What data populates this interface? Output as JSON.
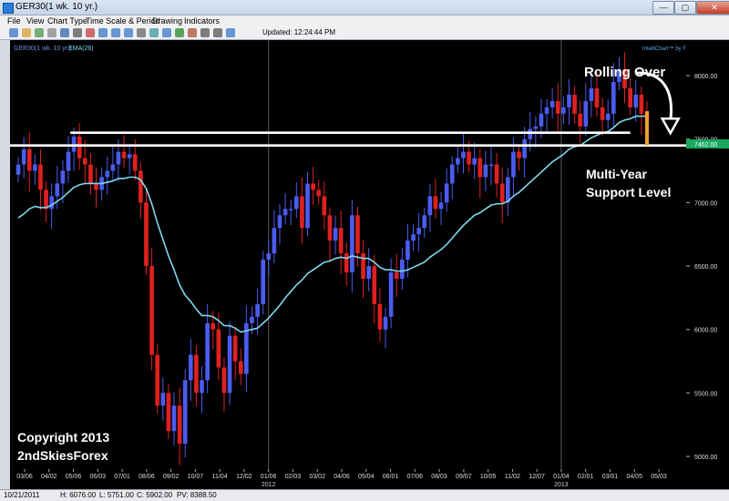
{
  "window": {
    "title": "GER30(1 wk.  10 yr.)",
    "controls": [
      "—",
      "▢",
      "✕"
    ]
  },
  "menu": [
    "File",
    "View",
    "Chart Type",
    "Time Scale & Period",
    "Drawing",
    "Indicators"
  ],
  "toolbar": {
    "updated": "Updated: 12:24:44 PM",
    "icons": [
      "new-icon",
      "open-icon",
      "save-icon",
      "print-icon",
      "line-tool-icon",
      "cursor-icon",
      "text-tool-icon",
      "crosshair-icon",
      "zoom-in-icon",
      "zoom-out-icon",
      "hand-icon",
      "fibonacci-icon",
      "bars-icon",
      "text-icon",
      "color-icon",
      "step-back-icon",
      "step-forward-icon",
      "pan-icon"
    ]
  },
  "legend": {
    "symbol": "GER30(1 wk.  10 yr.)",
    "ema": "EMA(26)",
    "watermark": "IntelliChart™ by FXtrek.com"
  },
  "annotations": {
    "rolling_over": "Rolling Over",
    "support_1": "Multi-Year",
    "support_2": "Support Level",
    "copyright_1": "Copyright 2013",
    "copyright_2": "2ndSkiesForex"
  },
  "status": {
    "date": "10/21/2011",
    "high": "H: 6076.00",
    "low": "L: 5751.00",
    "close": "C: 5902.00",
    "pv": "PV: 8388.50"
  },
  "chart_data": {
    "type": "candlestick",
    "symbol": "GER30",
    "timeframe": "1 wk",
    "ylim": [
      4900,
      8280
    ],
    "y_ticks": [
      5000,
      5500,
      6000,
      6500,
      7000,
      7500,
      8000
    ],
    "current_price": "7462.00",
    "x_ticks": [
      "03/06",
      "04/02",
      "05/06",
      "06/03",
      "07/01",
      "08/06",
      "09/02",
      "10/07",
      "11/04",
      "12/02",
      "01/06",
      "02/03",
      "03/02",
      "04/06",
      "05/04",
      "06/01",
      "07/06",
      "08/03",
      "09/07",
      "10/05",
      "11/02",
      "12/07",
      "01/04",
      "02/01",
      "03/01",
      "04/05",
      "05/03"
    ],
    "year_labels": [
      {
        "label": "2012",
        "at": "01/06"
      },
      {
        "label": "2013",
        "at": "01/04"
      }
    ],
    "support_lines": [
      7450,
      7550
    ],
    "closes": [
      7300,
      7420,
      7250,
      7300,
      7100,
      6950,
      7050,
      7150,
      7250,
      7400,
      7520,
      7350,
      7300,
      7150,
      7100,
      7200,
      7250,
      7300,
      7400,
      7350,
      7380,
      7250,
      7000,
      6500,
      5800,
      5400,
      5500,
      5200,
      5400,
      5100,
      5600,
      5800,
      5500,
      5600,
      6050,
      6000,
      5700,
      5500,
      5950,
      5750,
      5650,
      6050,
      6100,
      6200,
      6550,
      6600,
      6800,
      6900,
      6950,
      6950,
      7050,
      6800,
      7150,
      7100,
      7050,
      6900,
      6700,
      6800,
      6600,
      6450,
      6900,
      6600,
      6400,
      6500,
      6200,
      6000,
      6100,
      6450,
      6400,
      6550,
      6700,
      6750,
      6800,
      6900,
      7050,
      6950,
      7000,
      7150,
      7300,
      7350,
      7400,
      7300,
      7350,
      7200,
      7300,
      7300,
      7150,
      7000,
      7200,
      7400,
      7350,
      7500,
      7580,
      7600,
      7700,
      7750,
      7800,
      7700,
      7750,
      7850,
      7700,
      7600,
      7800,
      7900,
      7750,
      7650,
      7700,
      7950,
      8050,
      7900,
      7750,
      7850,
      7700,
      7650
    ],
    "ema_26": [
      6880,
      6910,
      6950,
      6970,
      6960,
      6960,
      6980,
      7010,
      7040,
      7080,
      7120,
      7140,
      7150,
      7150,
      7150,
      7150,
      7160,
      7170,
      7190,
      7190,
      7200,
      7200,
      7180,
      7110,
      6990,
      6840,
      6710,
      6580,
      6470,
      6350,
      6270,
      6220,
      6160,
      6110,
      6110,
      6100,
      6070,
      6030,
      6030,
      6010,
      5980,
      5990,
      6000,
      6010,
      6050,
      6090,
      6140,
      6190,
      6250,
      6300,
      6350,
      6390,
      6440,
      6470,
      6500,
      6530,
      6540,
      6560,
      6570,
      6560,
      6580,
      6570,
      6560,
      6560,
      6530,
      6490,
      6470,
      6470,
      6460,
      6460,
      6470,
      6490,
      6510,
      6530,
      6570,
      6600,
      6630,
      6670,
      6720,
      6770,
      6820,
      6860,
      6900,
      6920,
      6950,
      6980,
      6990,
      6990,
      7010,
      7050,
      7080,
      7120,
      7160,
      7200,
      7240,
      7280,
      7320,
      7350,
      7380,
      7420,
      7440,
      7450,
      7480,
      7510,
      7530,
      7550,
      7560,
      7590,
      7630,
      7650,
      7660,
      7680,
      7680,
      7680
    ]
  }
}
